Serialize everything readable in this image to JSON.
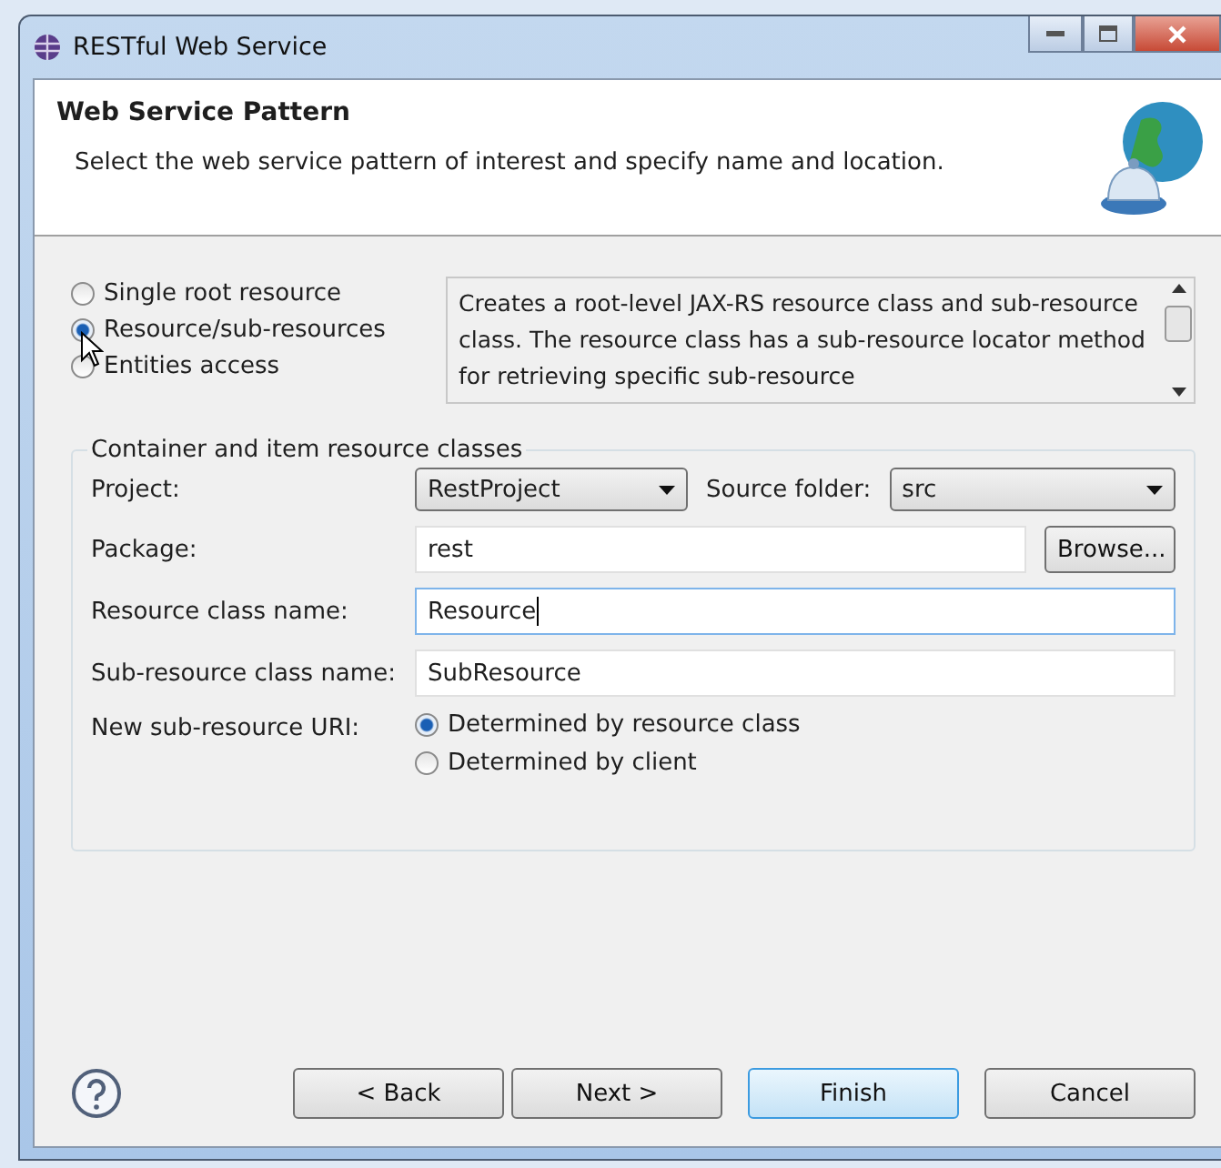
{
  "window": {
    "title": "RESTful Web Service"
  },
  "header": {
    "title": "Web Service Pattern",
    "description": "Select the web service pattern of interest and specify name and location."
  },
  "patterns": [
    {
      "label": "Single root resource",
      "selected": false
    },
    {
      "label": "Resource/sub-resources",
      "selected": true
    },
    {
      "label": "Entities access",
      "selected": false
    }
  ],
  "pattern_description": "Creates a root-level JAX-RS resource class and sub-resource class. The resource class has a sub-resource locator method for retrieving specific sub-resource",
  "group": {
    "title": "Container and item resource classes",
    "project": {
      "label": "Project:",
      "value": "RestProject"
    },
    "source_folder": {
      "label": "Source folder:",
      "value": "src"
    },
    "package": {
      "label": "Package:",
      "value": "rest",
      "button": "Browse..."
    },
    "fields": [
      {
        "label": "Resource class name:",
        "value": "Resource",
        "focused": true
      },
      {
        "label": "Sub-resource class name:",
        "value": "SubResource",
        "focused": false
      }
    ],
    "uri": {
      "label": "New sub-resource URI:",
      "options": [
        {
          "label": "Determined by resource class",
          "selected": true
        },
        {
          "label": "Determined by client",
          "selected": false
        }
      ]
    }
  },
  "buttons": [
    {
      "label": "< Back",
      "default": false
    },
    {
      "label": "Next >",
      "default": false
    },
    {
      "label": "Finish",
      "default": true
    },
    {
      "label": "Cancel",
      "default": false
    }
  ]
}
